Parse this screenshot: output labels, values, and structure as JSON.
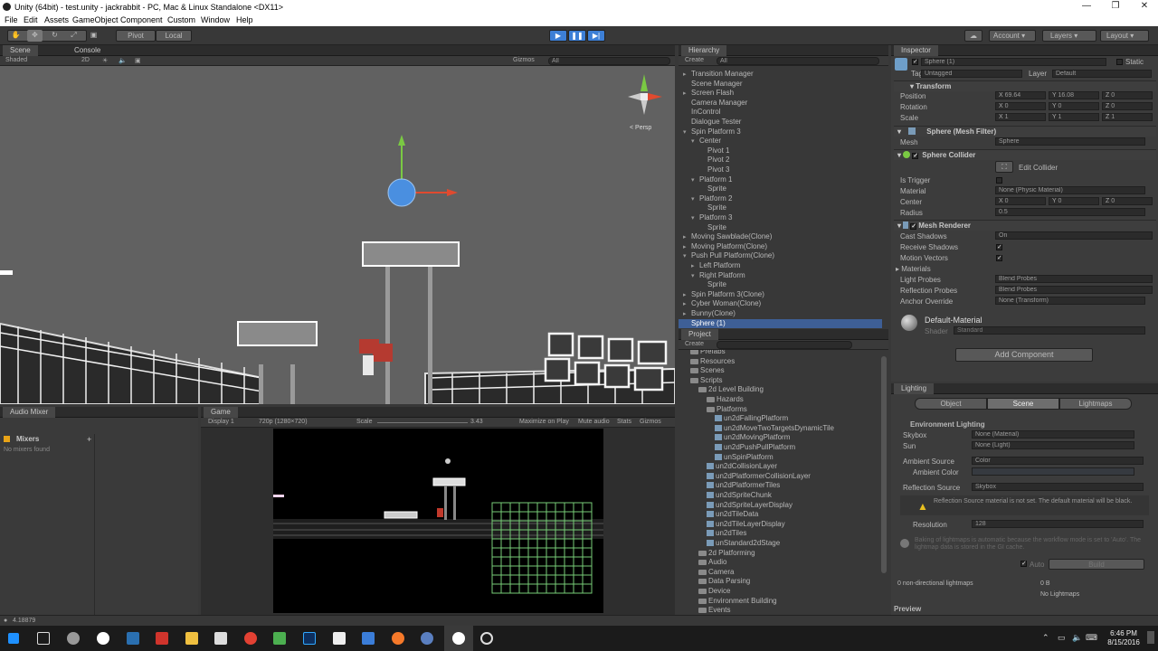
{
  "window": {
    "title": "Unity (64bit) - test.unity - jackrabbit - PC, Mac & Linux Standalone <DX11>"
  },
  "menu": [
    "File",
    "Edit",
    "Assets",
    "GameObject",
    "Component",
    "Custom",
    "Window",
    "Help"
  ],
  "toolbar": {
    "pivot": "Pivot",
    "local": "Local",
    "account": "Account",
    "layers": "Layers",
    "layout": "Layout"
  },
  "scene": {
    "tab": "Scene",
    "console_tab": "Console",
    "shading": "Shaded",
    "mode2d": "2D",
    "gizmos": "Gizmos",
    "search": "All",
    "persp": "< Persp"
  },
  "audio_mixer": {
    "tab": "Audio Mixer",
    "mixers": "Mixers",
    "add": "+",
    "empty": "No mixers found"
  },
  "game": {
    "tab": "Game",
    "display": "Display 1",
    "resolution": "720p (1280×720)",
    "scale_label": "Scale",
    "scale_value": "3.43",
    "maximize": "Maximize on Play",
    "mute": "Mute audio",
    "stats": "Stats",
    "gizmos": "Gizmos"
  },
  "hierarchy": {
    "tab": "Hierarchy",
    "create": "Create",
    "search": "All",
    "items": [
      {
        "label": "Transition Manager",
        "indent": 0,
        "arrow": "▸"
      },
      {
        "label": "Scene Manager",
        "indent": 0,
        "arrow": ""
      },
      {
        "label": "Screen Flash",
        "indent": 0,
        "arrow": "▸"
      },
      {
        "label": "Camera Manager",
        "indent": 0,
        "arrow": ""
      },
      {
        "label": "InControl",
        "indent": 0,
        "arrow": ""
      },
      {
        "label": "Dialogue Tester",
        "indent": 0,
        "arrow": ""
      },
      {
        "label": "Spin Platform 3",
        "indent": 0,
        "arrow": "▾"
      },
      {
        "label": "Center",
        "indent": 1,
        "arrow": "▾"
      },
      {
        "label": "Pivot 1",
        "indent": 2,
        "arrow": ""
      },
      {
        "label": "Pivot 2",
        "indent": 2,
        "arrow": ""
      },
      {
        "label": "Pivot 3",
        "indent": 2,
        "arrow": ""
      },
      {
        "label": "Platform 1",
        "indent": 1,
        "arrow": "▾"
      },
      {
        "label": "Sprite",
        "indent": 2,
        "arrow": ""
      },
      {
        "label": "Platform 2",
        "indent": 1,
        "arrow": "▾"
      },
      {
        "label": "Sprite",
        "indent": 2,
        "arrow": ""
      },
      {
        "label": "Platform 3",
        "indent": 1,
        "arrow": "▾"
      },
      {
        "label": "Sprite",
        "indent": 2,
        "arrow": ""
      },
      {
        "label": "Moving Sawblade(Clone)",
        "indent": 0,
        "arrow": "▸"
      },
      {
        "label": "Moving Platform(Clone)",
        "indent": 0,
        "arrow": "▸"
      },
      {
        "label": "Push Pull Platform(Clone)",
        "indent": 0,
        "arrow": "▾"
      },
      {
        "label": "Left Platform",
        "indent": 1,
        "arrow": "▸"
      },
      {
        "label": "Right Platform",
        "indent": 1,
        "arrow": "▾"
      },
      {
        "label": "Sprite",
        "indent": 2,
        "arrow": ""
      },
      {
        "label": "Spin Platform 3(Clone)",
        "indent": 0,
        "arrow": "▸"
      },
      {
        "label": "Cyber Woman(Clone)",
        "indent": 0,
        "arrow": "▸"
      },
      {
        "label": "Bunny(Clone)",
        "indent": 0,
        "arrow": "▸"
      },
      {
        "label": "Sphere (1)",
        "indent": 0,
        "arrow": "",
        "selected": true
      }
    ]
  },
  "project": {
    "tab": "Project",
    "create": "Create",
    "items": [
      {
        "label": "Prefabs",
        "indent": 1,
        "type": "folder"
      },
      {
        "label": "Resources",
        "indent": 1,
        "type": "folder"
      },
      {
        "label": "Scenes",
        "indent": 1,
        "type": "folder"
      },
      {
        "label": "Scripts",
        "indent": 1,
        "type": "folder"
      },
      {
        "label": "2d Level Building",
        "indent": 2,
        "type": "folder"
      },
      {
        "label": "Hazards",
        "indent": 3,
        "type": "folder"
      },
      {
        "label": "Platforms",
        "indent": 3,
        "type": "folder"
      },
      {
        "label": "un2dFallingPlatform",
        "indent": 4,
        "type": "script"
      },
      {
        "label": "un2dMoveTwoTargetsDynamicTile",
        "indent": 4,
        "type": "script"
      },
      {
        "label": "un2dMovingPlatform",
        "indent": 4,
        "type": "script"
      },
      {
        "label": "un2dPushPullPlatform",
        "indent": 4,
        "type": "script"
      },
      {
        "label": "unSpinPlatform",
        "indent": 4,
        "type": "script"
      },
      {
        "label": "un2dCollisionLayer",
        "indent": 3,
        "type": "script"
      },
      {
        "label": "un2dPlatformerCollisionLayer",
        "indent": 3,
        "type": "script"
      },
      {
        "label": "un2dPlatformerTiles",
        "indent": 3,
        "type": "script"
      },
      {
        "label": "un2dSpriteChunk",
        "indent": 3,
        "type": "script"
      },
      {
        "label": "un2dSpriteLayerDisplay",
        "indent": 3,
        "type": "script"
      },
      {
        "label": "un2dTileData",
        "indent": 3,
        "type": "script"
      },
      {
        "label": "un2dTileLayerDisplay",
        "indent": 3,
        "type": "script"
      },
      {
        "label": "un2dTiles",
        "indent": 3,
        "type": "script"
      },
      {
        "label": "unStandard2dStage",
        "indent": 3,
        "type": "script"
      },
      {
        "label": "2d Platforming",
        "indent": 2,
        "type": "folder"
      },
      {
        "label": "Audio",
        "indent": 2,
        "type": "folder"
      },
      {
        "label": "Camera",
        "indent": 2,
        "type": "folder"
      },
      {
        "label": "Data Parsing",
        "indent": 2,
        "type": "folder"
      },
      {
        "label": "Device",
        "indent": 2,
        "type": "folder"
      },
      {
        "label": "Environment Building",
        "indent": 2,
        "type": "folder"
      },
      {
        "label": "Events",
        "indent": 2,
        "type": "folder"
      }
    ]
  },
  "inspector": {
    "tab": "Inspector",
    "name": "Sphere (1)",
    "static": "Static",
    "tag_label": "Tag",
    "tag": "Untagged",
    "layer_label": "Layer",
    "layer": "Default",
    "transform": {
      "title": "Transform",
      "rows": [
        {
          "label": "Position",
          "x": "69.64",
          "y": "16.08",
          "z": "0"
        },
        {
          "label": "Rotation",
          "x": "0",
          "y": "0",
          "z": "0"
        },
        {
          "label": "Scale",
          "x": "1",
          "y": "1",
          "z": "1"
        }
      ]
    },
    "mesh_filter": {
      "title": "Sphere (Mesh Filter)",
      "mesh_label": "Mesh",
      "mesh": "Sphere"
    },
    "collider": {
      "title": "Sphere Collider",
      "edit": "Edit Collider",
      "trigger": "Is Trigger",
      "material_label": "Material",
      "material": "None (Physic Material)",
      "center_label": "Center",
      "cx": "0",
      "cy": "0",
      "cz": "0",
      "radius_label": "Radius",
      "radius": "0.5"
    },
    "renderer": {
      "title": "Mesh Renderer",
      "cast_label": "Cast Shadows",
      "cast": "On",
      "receive": "Receive Shadows",
      "motion": "Motion Vectors",
      "materials": "Materials",
      "light_label": "Light Probes",
      "light": "Blend Probes",
      "refl_label": "Reflection Probes",
      "refl": "Blend Probes",
      "anchor_label": "Anchor Override",
      "anchor": "None (Transform)"
    },
    "material": {
      "name": "Default-Material",
      "shader_label": "Shader",
      "shader": "Standard"
    },
    "add_component": "Add Component"
  },
  "lighting": {
    "tab": "Lighting",
    "tabs": [
      "Object",
      "Scene",
      "Lightmaps"
    ],
    "env": "Environment Lighting",
    "skybox_label": "Skybox",
    "skybox": "None (Material)",
    "sun_label": "Sun",
    "sun": "None (Light)",
    "ambient_src_label": "Ambient Source",
    "ambient_src": "Color",
    "ambient_color_label": "Ambient Color",
    "refl_src_label": "Reflection Source",
    "refl_src": "Skybox",
    "warning": "Reflection Source material is not set. The default material will be black.",
    "res_label": "Resolution",
    "res": "128",
    "bake_info": "Baking of lightmaps is automatic because the workflow mode is set to 'Auto'. The lightmap data is stored in the GI cache.",
    "auto": "Auto",
    "build": "Build",
    "nondir": "0 non-directional lightmaps",
    "size": "0 B",
    "no_lightmaps": "No Lightmaps",
    "preview": "Preview"
  },
  "status": {
    "text": "4.18879"
  },
  "taskbar": {
    "time": "6:46 PM",
    "date": "8/15/2016"
  }
}
